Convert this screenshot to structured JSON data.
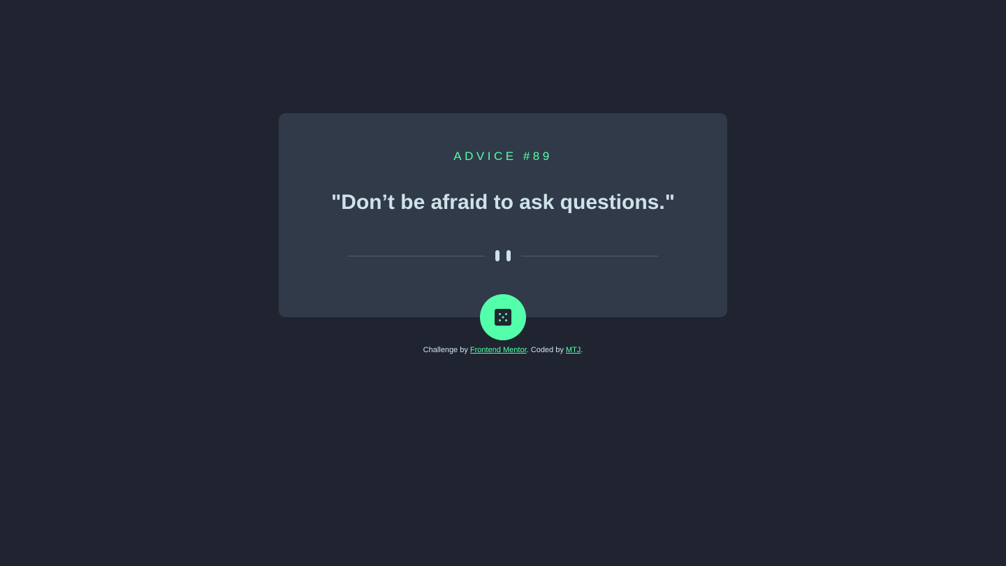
{
  "card": {
    "advice_id": "ADVICE #89",
    "advice_text": "\"Don’t be afraid to ask questions.\""
  },
  "icons": {
    "divider": "pause-icon",
    "dice_button": "dice-icon"
  },
  "attribution": {
    "prefix": "Challenge by ",
    "link1": "Frontend Mentor",
    "middle": ". Coded by ",
    "link2": "MTJ",
    "suffix": "."
  },
  "colors": {
    "background": "#1f2430",
    "card": "#313a48",
    "accent": "#53ffaa",
    "text": "#cee3e9"
  }
}
